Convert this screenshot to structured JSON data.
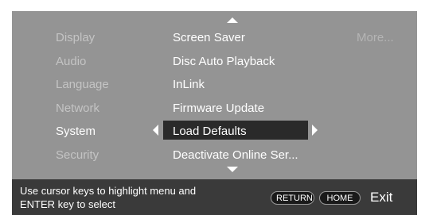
{
  "menu": {
    "left_items": [
      "Display",
      "Audio",
      "Language",
      "Network",
      "System",
      "Security"
    ],
    "selected_left": "System",
    "center_items": [
      "Screen Saver",
      "Disc Auto Playback",
      "InLink",
      "Firmware Update",
      "Load Defaults",
      "Deactivate Online Ser..."
    ],
    "selected_center": "Load Defaults",
    "more_label": "More..."
  },
  "footer": {
    "help_line1": "Use cursor keys to highlight menu and",
    "help_line2": "ENTER key to select",
    "return_label": "RETURN",
    "home_label": "HOME",
    "exit_label": "Exit"
  },
  "colors": {
    "background": "#949494",
    "footer": "#3a3a3a",
    "highlight": "#2a2a2a",
    "inactive_text": "#c4c4c4",
    "active_text": "#ffffff"
  },
  "icons": [
    "arrow-up-icon",
    "arrow-down-icon",
    "arrow-left-icon",
    "arrow-right-icon"
  ]
}
